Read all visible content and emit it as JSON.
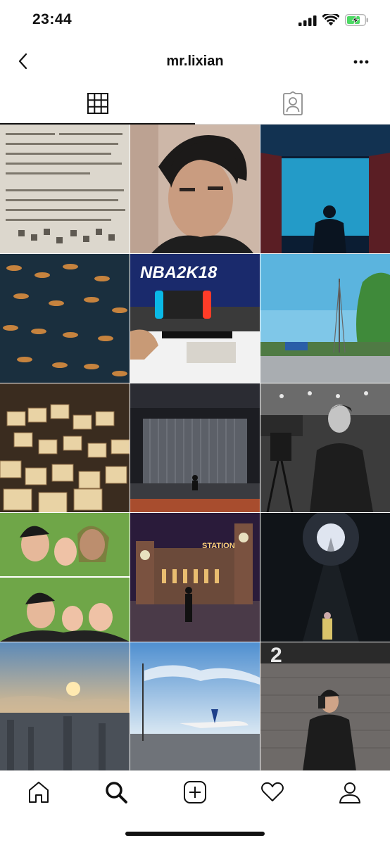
{
  "status_bar": {
    "time": "23:44",
    "icons": [
      "cellular-signal-icon",
      "wifi-icon",
      "battery-charging-icon"
    ],
    "battery_color": "#4cd964"
  },
  "header": {
    "title": "mr.lixian",
    "back_icon": "chevron-left-icon",
    "more_icon": "more-horizontal-icon"
  },
  "tabs": [
    {
      "id": "grid",
      "icon": "grid-icon",
      "active": true
    },
    {
      "id": "tagged",
      "icon": "tagged-user-icon",
      "active": false
    }
  ],
  "grid": {
    "photos": [
      {
        "id": "photo-1",
        "overlay_text": ""
      },
      {
        "id": "photo-2",
        "overlay_text": ""
      },
      {
        "id": "photo-3",
        "overlay_text": ""
      },
      {
        "id": "photo-4",
        "overlay_text": ""
      },
      {
        "id": "photo-5",
        "overlay_text": "NBA2K18"
      },
      {
        "id": "photo-6",
        "overlay_text": ""
      },
      {
        "id": "photo-7",
        "overlay_text": ""
      },
      {
        "id": "photo-8",
        "overlay_text": ""
      },
      {
        "id": "photo-9",
        "overlay_text": ""
      },
      {
        "id": "photo-10",
        "overlay_text": ""
      },
      {
        "id": "photo-11",
        "overlay_text": "STATION"
      },
      {
        "id": "photo-12",
        "overlay_text": ""
      },
      {
        "id": "photo-13",
        "overlay_text": ""
      },
      {
        "id": "photo-14",
        "overlay_text": ""
      },
      {
        "id": "photo-15",
        "overlay_text": "2"
      }
    ]
  },
  "bottom_nav": [
    {
      "id": "home",
      "icon": "home-icon"
    },
    {
      "id": "search",
      "icon": "search-icon",
      "active": true
    },
    {
      "id": "create",
      "icon": "add-post-icon"
    },
    {
      "id": "activity",
      "icon": "heart-icon"
    },
    {
      "id": "profile",
      "icon": "profile-icon"
    }
  ]
}
